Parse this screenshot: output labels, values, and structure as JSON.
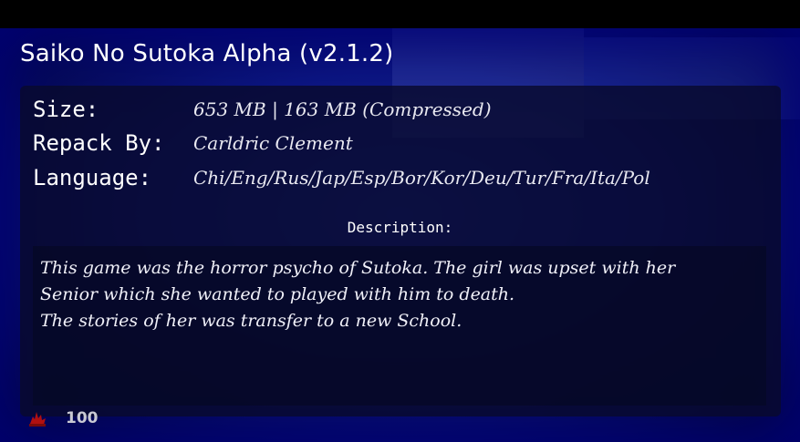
{
  "title": "Saiko No Sutoka Alpha (v2.1.2)",
  "info": [
    {
      "label": "Size:",
      "value": "653 MB | 163 MB (Compressed)"
    },
    {
      "label": "Repack By:",
      "value": "Carldric Clement"
    },
    {
      "label": "Language:",
      "value": "Chi/Eng/Rus/Jap/Esp/Bor/Kor/Deu/Tur/Fra/Ita/Pol"
    }
  ],
  "description": {
    "heading": "Description:",
    "text": "This game was the horror psycho of Sutoka. The girl was upset with her\nSenior which she wanted to played with him to death.\nThe stories of her was transfer to a new School."
  },
  "hud": {
    "icon": "blood-splat-icon",
    "value": "100"
  },
  "colors": {
    "background_blue": "#0c1680",
    "panel": "#080a2d",
    "text": "#ffffff",
    "hud_icon": "#b01010"
  }
}
